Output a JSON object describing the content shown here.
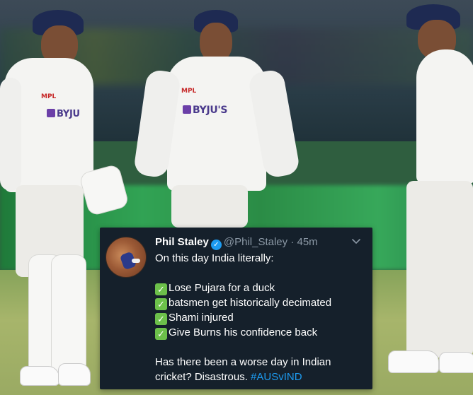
{
  "photo": {
    "sponsor_text": "BYJU'S",
    "sponsor_text_partial": "BYJU",
    "kit_logo": "MPL"
  },
  "tweet": {
    "author_name": "Phil Staley",
    "verified_icon": "verified-badge-icon",
    "handle": "@Phil_Staley",
    "separator": "·",
    "time": "45m",
    "menu_icon": "chevron-down-icon",
    "intro": "On this day India literally:",
    "checklist": [
      "Lose Pujara for a duck",
      "batsmen get historically decimated",
      "Shami injured",
      "Give Burns his confidence back"
    ],
    "check_icon": "white-heavy-check-mark-emoji",
    "closing_line_1": "Has there been a worse day in Indian",
    "closing_line_2": "cricket? Disastrous.",
    "hashtag": "#AUSvIND",
    "colors": {
      "background": "#15202b",
      "text": "#ffffff",
      "secondary": "#8b98a5",
      "link": "#1d9bf0",
      "check": "#6cc04a"
    }
  }
}
